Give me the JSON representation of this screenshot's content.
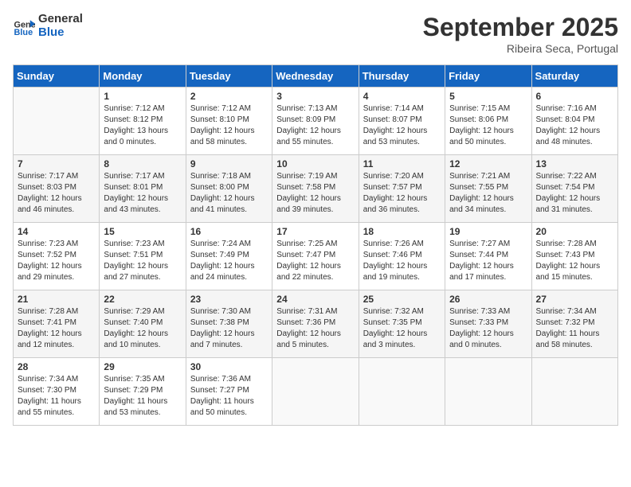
{
  "header": {
    "logo_line1": "General",
    "logo_line2": "Blue",
    "month": "September 2025",
    "location": "Ribeira Seca, Portugal"
  },
  "weekdays": [
    "Sunday",
    "Monday",
    "Tuesday",
    "Wednesday",
    "Thursday",
    "Friday",
    "Saturday"
  ],
  "weeks": [
    [
      {
        "day": "",
        "sunrise": "",
        "sunset": "",
        "daylight": ""
      },
      {
        "day": "1",
        "sunrise": "Sunrise: 7:12 AM",
        "sunset": "Sunset: 8:12 PM",
        "daylight": "Daylight: 13 hours and 0 minutes."
      },
      {
        "day": "2",
        "sunrise": "Sunrise: 7:12 AM",
        "sunset": "Sunset: 8:10 PM",
        "daylight": "Daylight: 12 hours and 58 minutes."
      },
      {
        "day": "3",
        "sunrise": "Sunrise: 7:13 AM",
        "sunset": "Sunset: 8:09 PM",
        "daylight": "Daylight: 12 hours and 55 minutes."
      },
      {
        "day": "4",
        "sunrise": "Sunrise: 7:14 AM",
        "sunset": "Sunset: 8:07 PM",
        "daylight": "Daylight: 12 hours and 53 minutes."
      },
      {
        "day": "5",
        "sunrise": "Sunrise: 7:15 AM",
        "sunset": "Sunset: 8:06 PM",
        "daylight": "Daylight: 12 hours and 50 minutes."
      },
      {
        "day": "6",
        "sunrise": "Sunrise: 7:16 AM",
        "sunset": "Sunset: 8:04 PM",
        "daylight": "Daylight: 12 hours and 48 minutes."
      }
    ],
    [
      {
        "day": "7",
        "sunrise": "Sunrise: 7:17 AM",
        "sunset": "Sunset: 8:03 PM",
        "daylight": "Daylight: 12 hours and 46 minutes."
      },
      {
        "day": "8",
        "sunrise": "Sunrise: 7:17 AM",
        "sunset": "Sunset: 8:01 PM",
        "daylight": "Daylight: 12 hours and 43 minutes."
      },
      {
        "day": "9",
        "sunrise": "Sunrise: 7:18 AM",
        "sunset": "Sunset: 8:00 PM",
        "daylight": "Daylight: 12 hours and 41 minutes."
      },
      {
        "day": "10",
        "sunrise": "Sunrise: 7:19 AM",
        "sunset": "Sunset: 7:58 PM",
        "daylight": "Daylight: 12 hours and 39 minutes."
      },
      {
        "day": "11",
        "sunrise": "Sunrise: 7:20 AM",
        "sunset": "Sunset: 7:57 PM",
        "daylight": "Daylight: 12 hours and 36 minutes."
      },
      {
        "day": "12",
        "sunrise": "Sunrise: 7:21 AM",
        "sunset": "Sunset: 7:55 PM",
        "daylight": "Daylight: 12 hours and 34 minutes."
      },
      {
        "day": "13",
        "sunrise": "Sunrise: 7:22 AM",
        "sunset": "Sunset: 7:54 PM",
        "daylight": "Daylight: 12 hours and 31 minutes."
      }
    ],
    [
      {
        "day": "14",
        "sunrise": "Sunrise: 7:23 AM",
        "sunset": "Sunset: 7:52 PM",
        "daylight": "Daylight: 12 hours and 29 minutes."
      },
      {
        "day": "15",
        "sunrise": "Sunrise: 7:23 AM",
        "sunset": "Sunset: 7:51 PM",
        "daylight": "Daylight: 12 hours and 27 minutes."
      },
      {
        "day": "16",
        "sunrise": "Sunrise: 7:24 AM",
        "sunset": "Sunset: 7:49 PM",
        "daylight": "Daylight: 12 hours and 24 minutes."
      },
      {
        "day": "17",
        "sunrise": "Sunrise: 7:25 AM",
        "sunset": "Sunset: 7:47 PM",
        "daylight": "Daylight: 12 hours and 22 minutes."
      },
      {
        "day": "18",
        "sunrise": "Sunrise: 7:26 AM",
        "sunset": "Sunset: 7:46 PM",
        "daylight": "Daylight: 12 hours and 19 minutes."
      },
      {
        "day": "19",
        "sunrise": "Sunrise: 7:27 AM",
        "sunset": "Sunset: 7:44 PM",
        "daylight": "Daylight: 12 hours and 17 minutes."
      },
      {
        "day": "20",
        "sunrise": "Sunrise: 7:28 AM",
        "sunset": "Sunset: 7:43 PM",
        "daylight": "Daylight: 12 hours and 15 minutes."
      }
    ],
    [
      {
        "day": "21",
        "sunrise": "Sunrise: 7:28 AM",
        "sunset": "Sunset: 7:41 PM",
        "daylight": "Daylight: 12 hours and 12 minutes."
      },
      {
        "day": "22",
        "sunrise": "Sunrise: 7:29 AM",
        "sunset": "Sunset: 7:40 PM",
        "daylight": "Daylight: 12 hours and 10 minutes."
      },
      {
        "day": "23",
        "sunrise": "Sunrise: 7:30 AM",
        "sunset": "Sunset: 7:38 PM",
        "daylight": "Daylight: 12 hours and 7 minutes."
      },
      {
        "day": "24",
        "sunrise": "Sunrise: 7:31 AM",
        "sunset": "Sunset: 7:36 PM",
        "daylight": "Daylight: 12 hours and 5 minutes."
      },
      {
        "day": "25",
        "sunrise": "Sunrise: 7:32 AM",
        "sunset": "Sunset: 7:35 PM",
        "daylight": "Daylight: 12 hours and 3 minutes."
      },
      {
        "day": "26",
        "sunrise": "Sunrise: 7:33 AM",
        "sunset": "Sunset: 7:33 PM",
        "daylight": "Daylight: 12 hours and 0 minutes."
      },
      {
        "day": "27",
        "sunrise": "Sunrise: 7:34 AM",
        "sunset": "Sunset: 7:32 PM",
        "daylight": "Daylight: 11 hours and 58 minutes."
      }
    ],
    [
      {
        "day": "28",
        "sunrise": "Sunrise: 7:34 AM",
        "sunset": "Sunset: 7:30 PM",
        "daylight": "Daylight: 11 hours and 55 minutes."
      },
      {
        "day": "29",
        "sunrise": "Sunrise: 7:35 AM",
        "sunset": "Sunset: 7:29 PM",
        "daylight": "Daylight: 11 hours and 53 minutes."
      },
      {
        "day": "30",
        "sunrise": "Sunrise: 7:36 AM",
        "sunset": "Sunset: 7:27 PM",
        "daylight": "Daylight: 11 hours and 50 minutes."
      },
      {
        "day": "",
        "sunrise": "",
        "sunset": "",
        "daylight": ""
      },
      {
        "day": "",
        "sunrise": "",
        "sunset": "",
        "daylight": ""
      },
      {
        "day": "",
        "sunrise": "",
        "sunset": "",
        "daylight": ""
      },
      {
        "day": "",
        "sunrise": "",
        "sunset": "",
        "daylight": ""
      }
    ]
  ]
}
